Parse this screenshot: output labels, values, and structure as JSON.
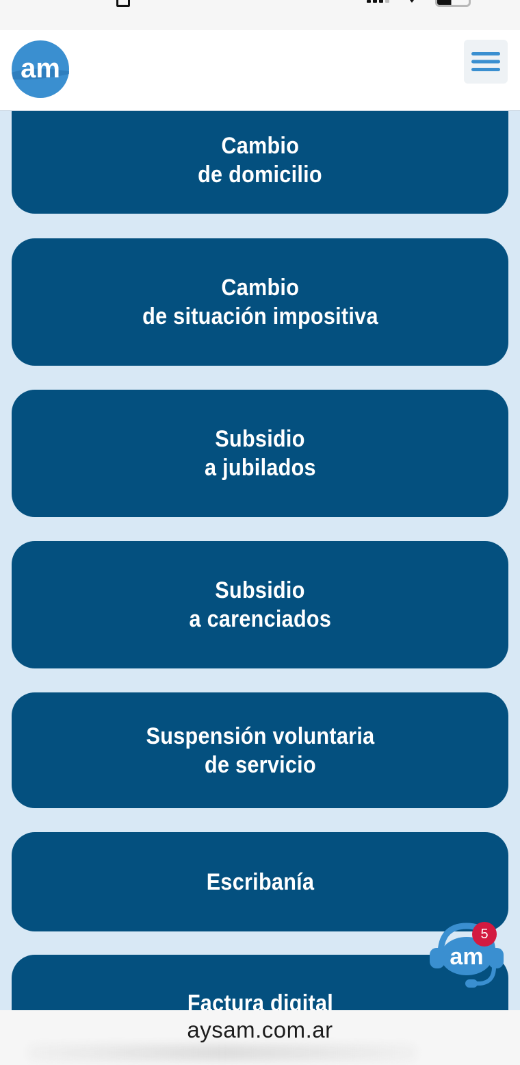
{
  "browser": {
    "url": "aysam.com.ar"
  },
  "header": {
    "logo_text": "am",
    "menu_icon": "hamburger-menu-icon"
  },
  "services": [
    {
      "line1": "Cambio",
      "line2": "de domicilio"
    },
    {
      "line1": "Cambio",
      "line2": "de situación impositiva"
    },
    {
      "line1": "Subsidio",
      "line2": "a jubilados"
    },
    {
      "line1": "Subsidio",
      "line2": "a carenciados"
    },
    {
      "line1": "Suspensión voluntaria",
      "line2": "de servicio"
    },
    {
      "line1": "Escribanía",
      "line2": ""
    },
    {
      "line1": "Factura digital",
      "line2": ""
    }
  ],
  "chat": {
    "icon": "support-headset-icon",
    "logo_text": "am",
    "badge_count": "5"
  },
  "colors": {
    "brand_blue": "#04507f",
    "page_background": "#d8e8f5",
    "badge_red": "#d31a40",
    "logo_blue": "#3a8fd0"
  }
}
